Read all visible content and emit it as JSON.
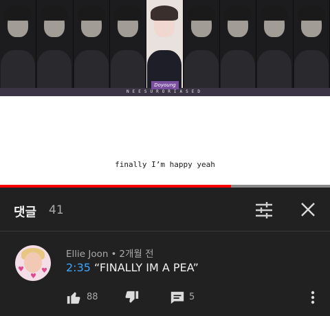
{
  "video": {
    "lyric": "finally I’m happy yeah",
    "name_tag": "Doyoung",
    "credit": "NEESURORIASED",
    "progress_fraction": 0.7
  },
  "comments": {
    "title": "댓글",
    "count": "41",
    "sort_icon": "sliders-icon",
    "close_icon": "close-icon"
  },
  "comment": {
    "author": "Ellie Joon",
    "separator": "•",
    "time": "2개월 전",
    "timestamp": "2:35",
    "text": "“FINALLY IM A PEA”",
    "likes": "88",
    "replies": "5",
    "like_icon": "thumbs-up-icon",
    "dislike_icon": "thumbs-down-icon",
    "reply_icon": "reply-icon",
    "more_icon": "more-vert-icon"
  },
  "colors": {
    "background": "#212121",
    "progress": "#ff0000",
    "timestamp_link": "#3ea6ff"
  }
}
